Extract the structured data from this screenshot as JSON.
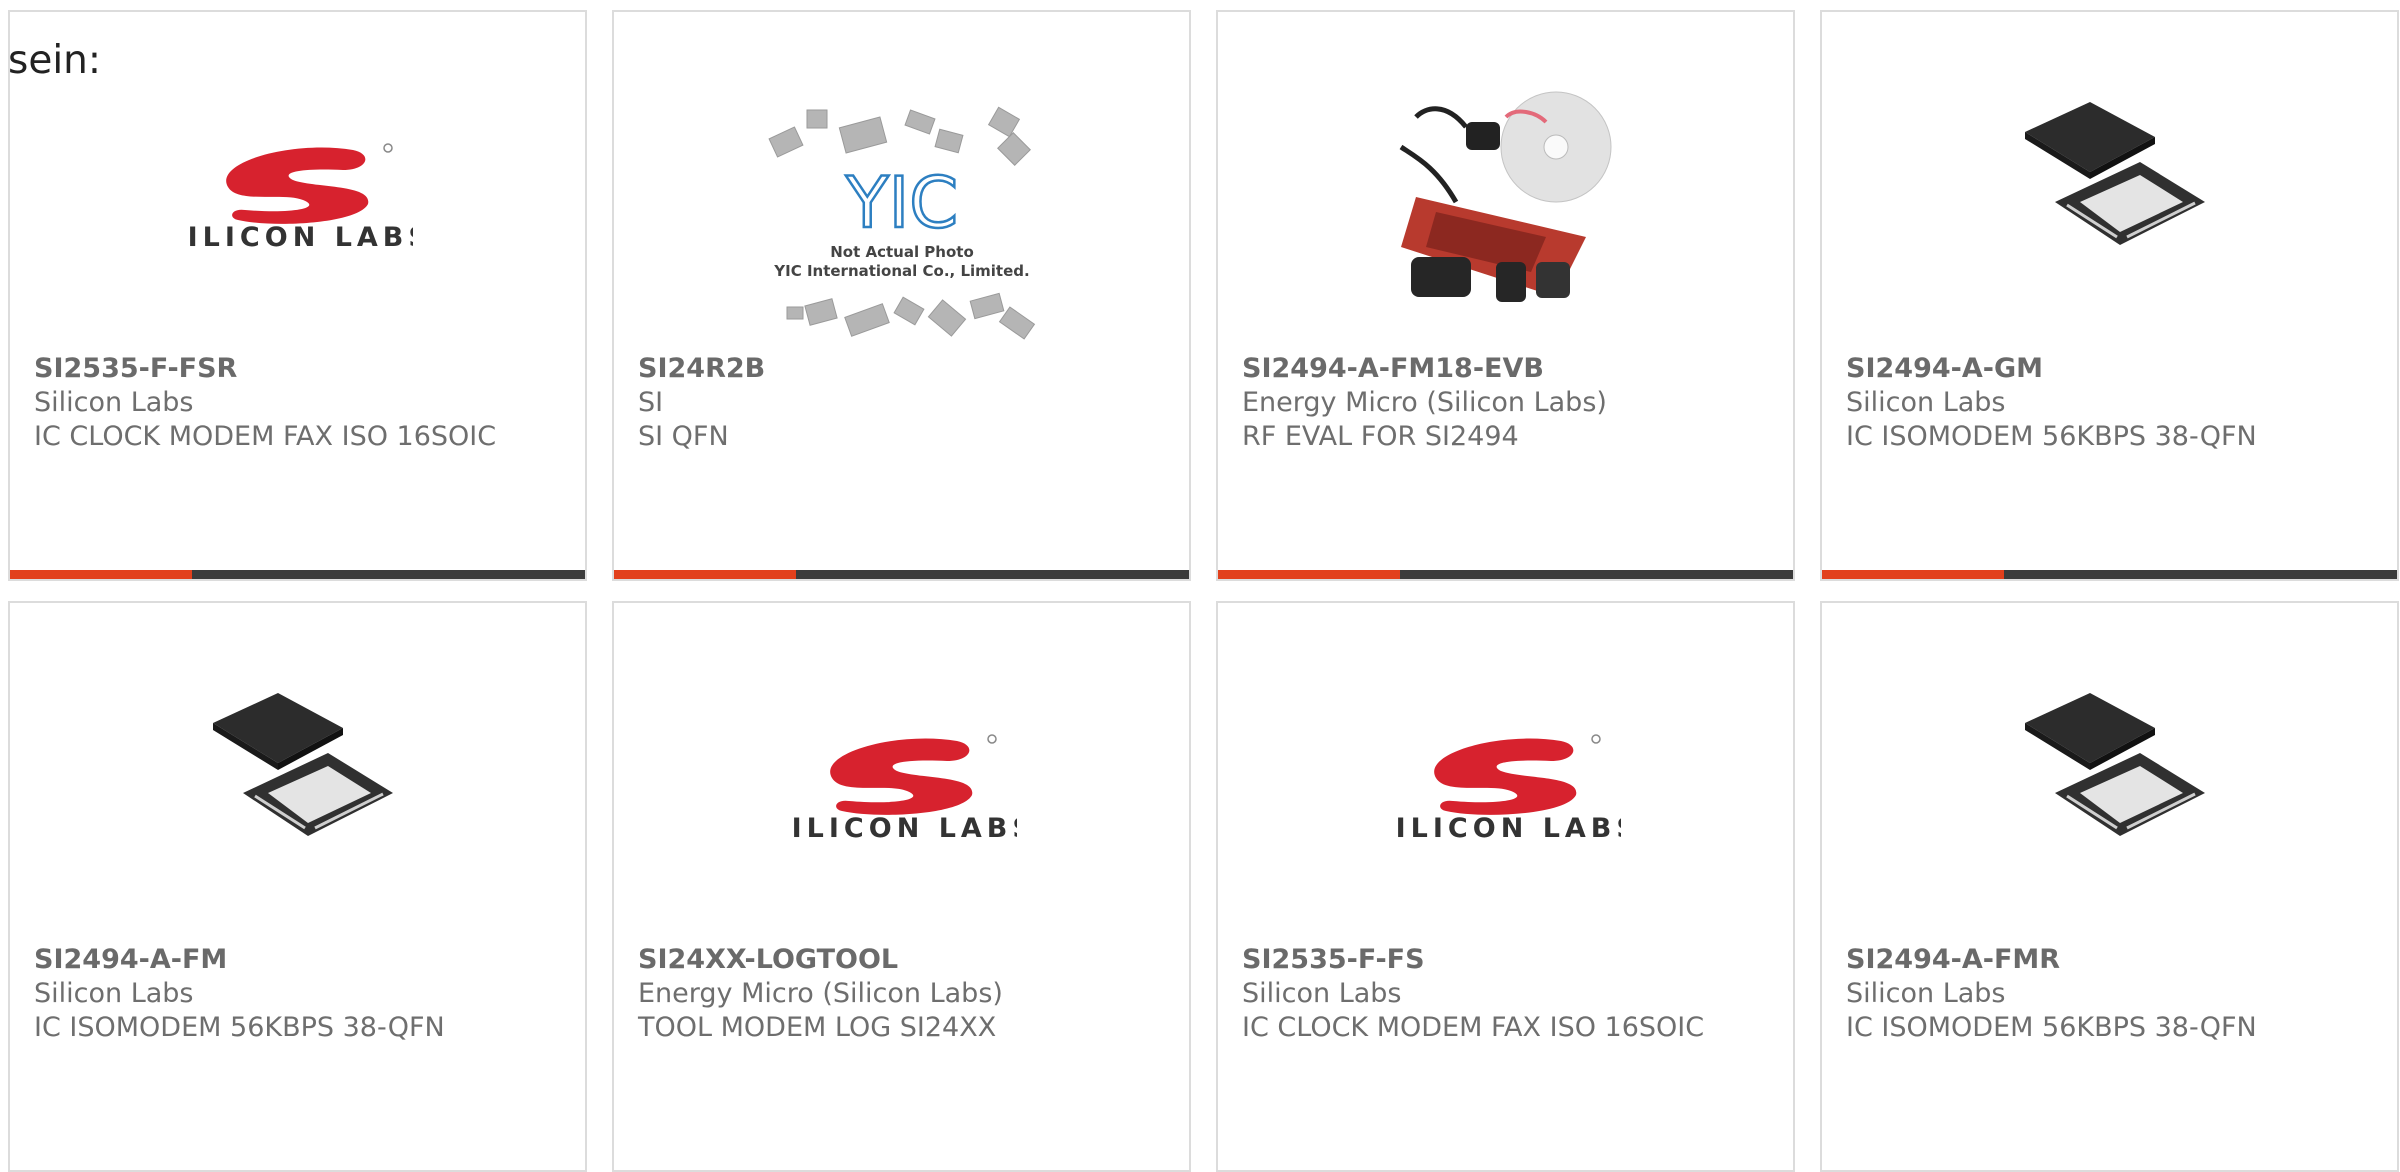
{
  "intro_text": "sein:",
  "colors": {
    "accent": "#e2401c",
    "bar": "#3b3b3b",
    "logo_red": "#d7222e"
  },
  "logo": {
    "silicon_labs_text": "SILICON LABS",
    "yic_text": "YIC",
    "yic_caption_1": "Not Actual Photo",
    "yic_caption_2": "YIC International Co., Limited."
  },
  "products": [
    {
      "part": "SI2535-F-FSR",
      "manufacturer": "Silicon Labs",
      "description": "IC CLOCK MODEM FAX ISO 16SOIC",
      "image": "silicon-labs-logo"
    },
    {
      "part": "SI24R2B",
      "manufacturer": "SI",
      "description": "SI QFN",
      "image": "yic-not-actual-photo"
    },
    {
      "part": "SI2494-A-FM18-EVB",
      "manufacturer": "Energy Micro (Silicon Labs)",
      "description": "RF EVAL FOR SI2494",
      "image": "evaluation-kit-photo"
    },
    {
      "part": "SI2494-A-GM",
      "manufacturer": "Silicon Labs",
      "description": "IC ISOMODEM 56KBPS 38-QFN",
      "image": "qfn-chip-photo"
    },
    {
      "part": "SI2494-A-FM",
      "manufacturer": "Silicon Labs",
      "description": "IC ISOMODEM 56KBPS 38-QFN",
      "image": "qfn-chip-photo"
    },
    {
      "part": "SI24XX-LOGTOOL",
      "manufacturer": "Energy Micro (Silicon Labs)",
      "description": "TOOL MODEM LOG SI24XX",
      "image": "silicon-labs-logo"
    },
    {
      "part": "SI2535-F-FS",
      "manufacturer": "Silicon Labs",
      "description": "IC CLOCK MODEM FAX ISO 16SOIC",
      "image": "silicon-labs-logo"
    },
    {
      "part": "SI2494-A-FMR",
      "manufacturer": "Silicon Labs",
      "description": "IC ISOMODEM 56KBPS 38-QFN",
      "image": "qfn-chip-photo"
    }
  ]
}
